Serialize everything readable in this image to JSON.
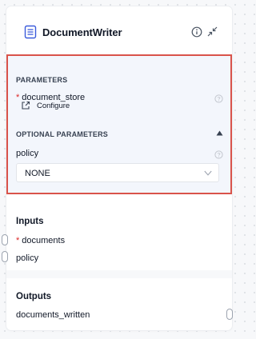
{
  "node": {
    "title": "DocumentWriter",
    "icon": "document-stack-icon"
  },
  "parameters": {
    "heading": "PARAMETERS",
    "document_store": {
      "label": "document_store",
      "required_marker": "*",
      "configure_label": "Configure"
    },
    "optional": {
      "heading": "OPTIONAL PARAMETERS",
      "expanded": true,
      "policy": {
        "label": "policy",
        "value": "NONE"
      }
    }
  },
  "inputs": {
    "heading": "Inputs",
    "items": [
      {
        "label": "documents",
        "required_marker": "*"
      },
      {
        "label": "policy",
        "required_marker": ""
      }
    ]
  },
  "outputs": {
    "heading": "Outputs",
    "items": [
      {
        "label": "documents_written"
      }
    ]
  },
  "colors": {
    "highlight_border": "#d9534a",
    "params_bg": "#f3f6fc",
    "accent_icon": "#3b5bdb",
    "required": "#dc2626"
  }
}
